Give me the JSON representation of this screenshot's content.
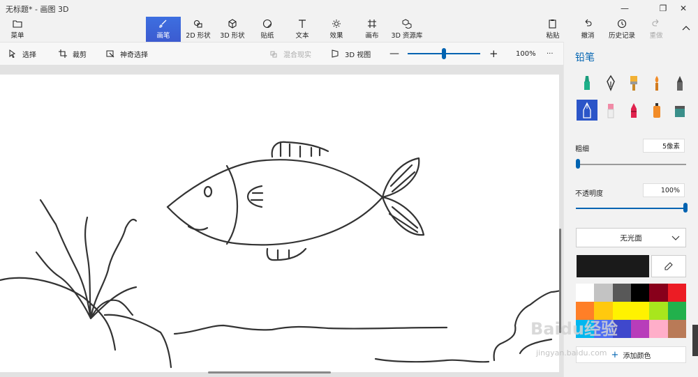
{
  "window": {
    "title": "无标题* - 画图 3D",
    "controls": [
      "minimize",
      "maximize",
      "close"
    ]
  },
  "ribbon": {
    "menu": "菜单",
    "tools": [
      {
        "label": "画笔",
        "icon": "brush-icon",
        "active": true
      },
      {
        "label": "2D 形状",
        "icon": "shape2d-icon"
      },
      {
        "label": "3D 形状",
        "icon": "shape3d-icon"
      },
      {
        "label": "贴纸",
        "icon": "sticker-icon"
      },
      {
        "label": "文本",
        "icon": "text-icon"
      },
      {
        "label": "效果",
        "icon": "effects-icon"
      },
      {
        "label": "画布",
        "icon": "canvas-icon"
      },
      {
        "label": "3D 资源库",
        "icon": "library-icon"
      }
    ],
    "right": [
      {
        "label": "粘贴",
        "icon": "paste-icon"
      },
      {
        "label": "撤消",
        "icon": "undo-icon"
      },
      {
        "label": "历史记录",
        "icon": "history-icon"
      },
      {
        "label": "重做",
        "icon": "redo-icon",
        "disabled": true
      }
    ]
  },
  "toolbar": {
    "select": "选择",
    "crop": "裁剪",
    "magic_select": "神奇选择",
    "mixed_reality": "混合现实",
    "view3d": "3D 视图",
    "zoom": "100%",
    "zoom_slider_value": 0.5,
    "more": "···"
  },
  "panel": {
    "title": "铅笔",
    "brushes": [
      "marker-icon",
      "calligraphy-pen-icon",
      "oil-brush-icon",
      "watercolor-icon",
      "pixel-pen-icon",
      "pencil-icon",
      "eraser-icon",
      "crayon-icon",
      "spray-can-icon",
      "fill-icon"
    ],
    "selected_brush": 5,
    "thickness_label": "粗细",
    "thickness_value": "5像素",
    "thickness_level": 0,
    "opacity_label": "不透明度",
    "opacity_value": "100%",
    "opacity_level": 1.0,
    "finish": "无光面",
    "current_color": "#1a1a1a",
    "palette": [
      "#ffffff",
      "#c3c3c3",
      "#585858",
      "#000000",
      "#88001b",
      "#ec1c24",
      "#ff7f27",
      "#ffc90e",
      "#fff200",
      "#fff200",
      "#a8e61d",
      "#22b14c",
      "#00b7ef",
      "#4d6df3",
      "#3f48cc",
      "#b83dba",
      "#ffaec9",
      "#b97a57"
    ],
    "add_color": "添加颜色"
  },
  "watermark": {
    "text": "Baidu经验",
    "sub": "jingyan.baidu.com"
  }
}
